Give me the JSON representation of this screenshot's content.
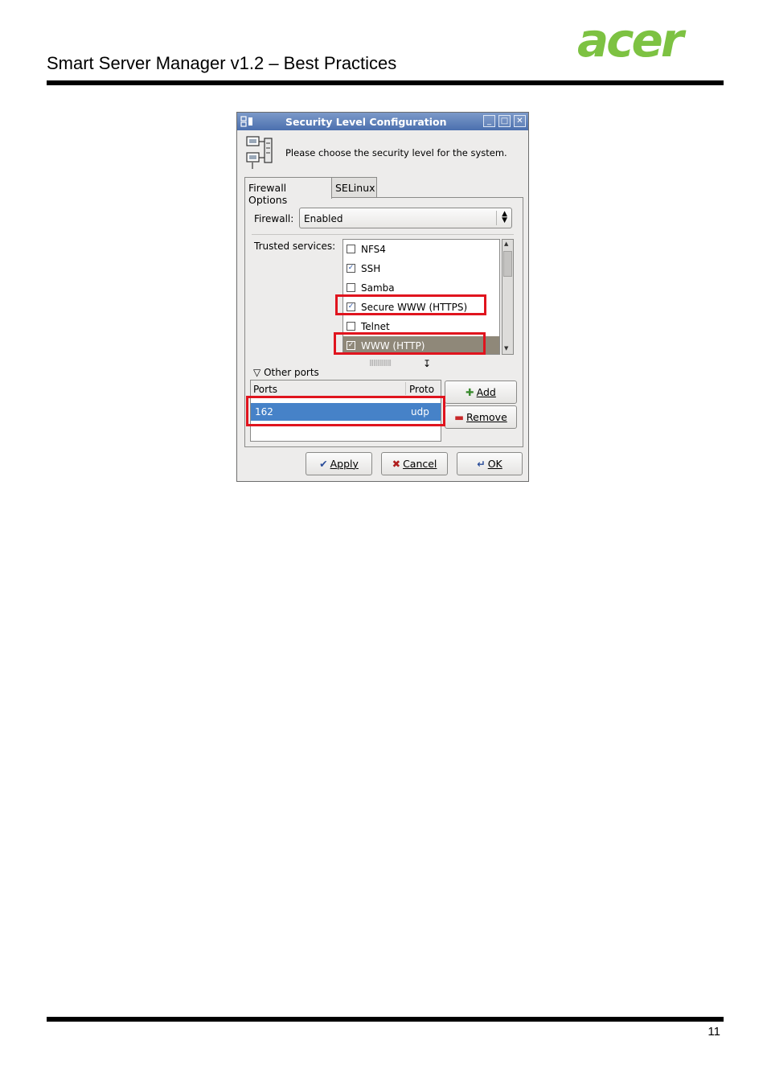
{
  "document": {
    "title": "Smart Server Manager v1.2 – Best Practices",
    "logo_text": "acer",
    "page_number": "11",
    "brand_color": "#7dc242"
  },
  "dialog": {
    "title": "Security Level Configuration",
    "intro": "Please choose the security level for the system.",
    "tabs": [
      {
        "label": "Firewall Options",
        "active": true
      },
      {
        "label": "SELinux",
        "active": false
      }
    ],
    "firewall_label": "Firewall:",
    "firewall_value": "Enabled",
    "trusted_label": "Trusted services:",
    "services": [
      {
        "label": "NFS4",
        "checked": false
      },
      {
        "label": "SSH",
        "checked": true
      },
      {
        "label": "Samba",
        "checked": false
      },
      {
        "label": "Secure WWW (HTTPS)",
        "checked": true
      },
      {
        "label": "Telnet",
        "checked": false
      },
      {
        "label": "WWW (HTTP)",
        "checked": true
      }
    ],
    "other_ports_label": "Other ports",
    "ports_columns": [
      "Ports",
      "Proto"
    ],
    "ports_rows": [
      {
        "port": "162",
        "proto": "udp"
      }
    ],
    "buttons": {
      "add": "Add",
      "remove": "Remove",
      "apply": "Apply",
      "cancel": "Cancel",
      "ok": "OK"
    },
    "highlight_color": "#e0141e"
  }
}
